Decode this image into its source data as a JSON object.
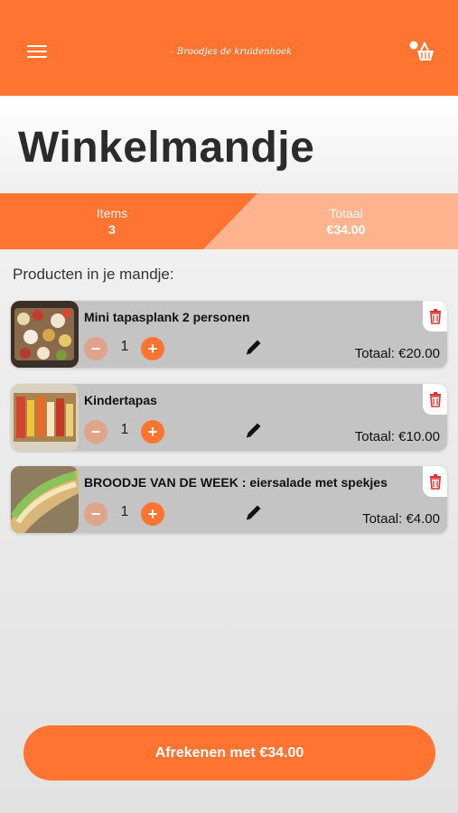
{
  "header": {
    "logo_text": "Broodjes de kruidenhoek",
    "menu_icon": "hamburger-icon",
    "cart_icon": "basket-icon"
  },
  "page": {
    "title": "Winkelmandje"
  },
  "summary": {
    "items_label": "Items",
    "items_value": "3",
    "total_label": "Totaal",
    "total_value": "€34.00"
  },
  "section_label": "Producten in je mandje:",
  "items": [
    {
      "name": "Mini tapasplank 2 personen",
      "qty": "1",
      "minus": "−",
      "plus": "+",
      "total": "Totaal: €20.00"
    },
    {
      "name": "Kindertapas",
      "qty": "1",
      "minus": "−",
      "plus": "+",
      "total": "Totaal: €10.00"
    },
    {
      "name": "BROODJE VAN DE WEEK : eiersalade met spekjes",
      "qty": "1",
      "minus": "−",
      "plus": "+",
      "total": "Totaal: €4.00"
    }
  ],
  "checkout": {
    "label": "Afrekenen met €34.00"
  },
  "colors": {
    "brand": "#ff7430",
    "brand_light": "#ffb38e",
    "card": "#c4c4c4",
    "delete": "#e0322e"
  }
}
